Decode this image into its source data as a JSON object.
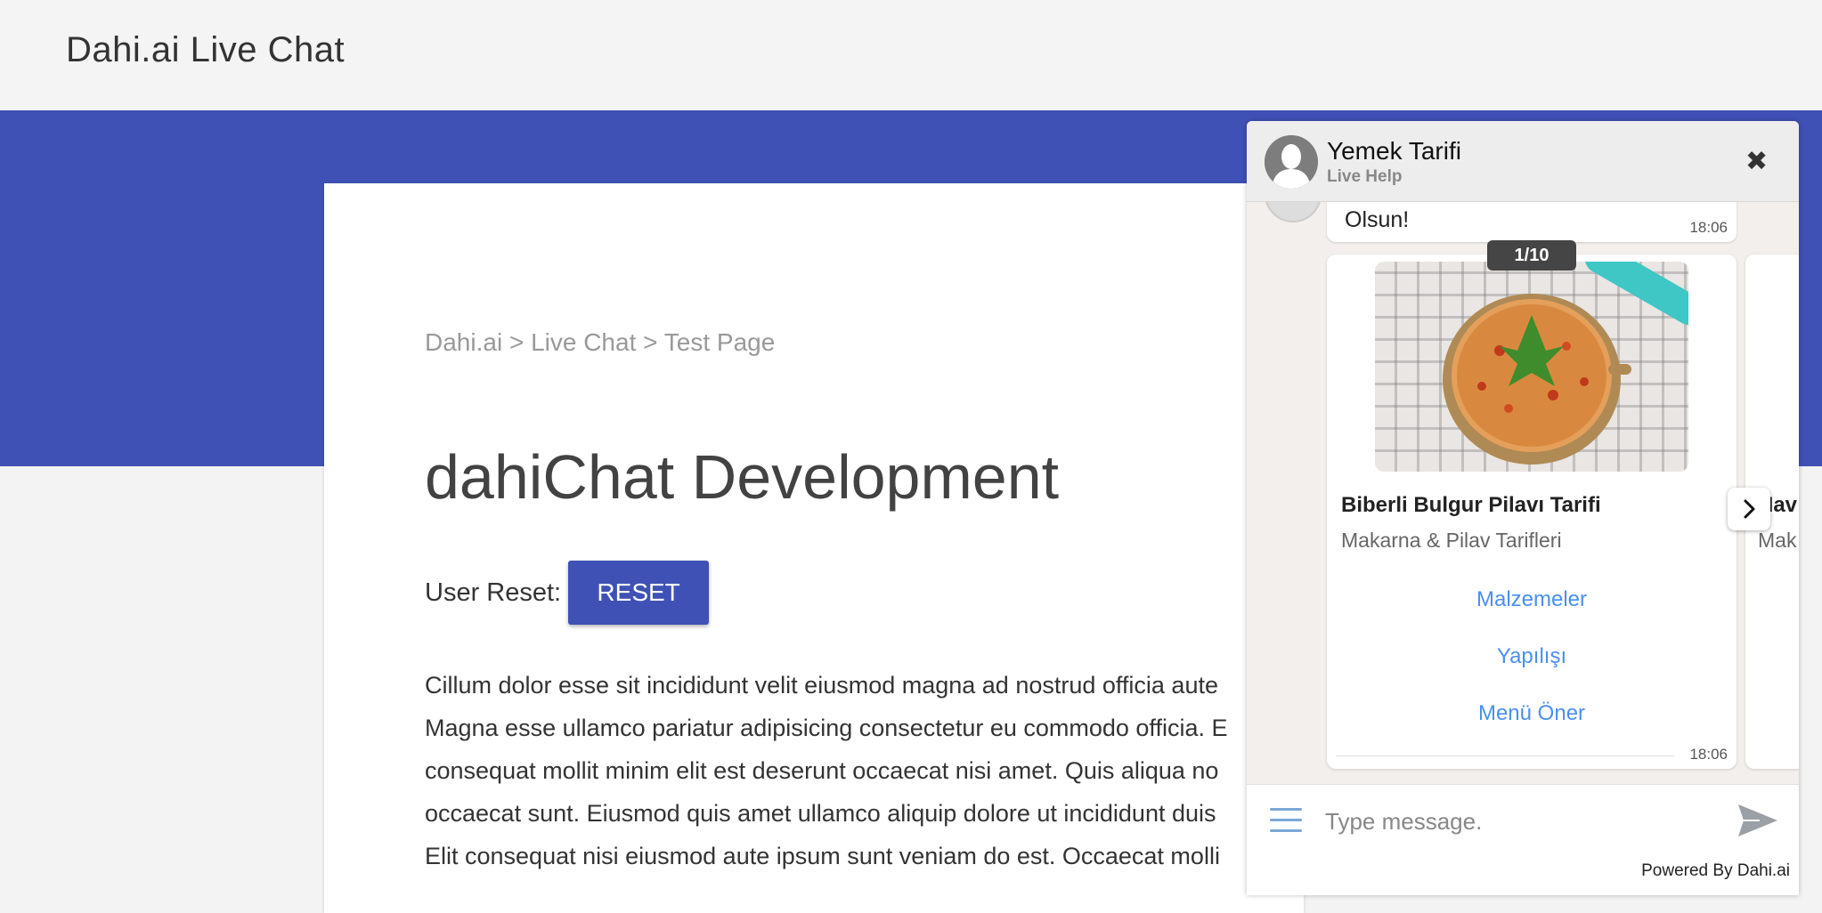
{
  "header": {
    "brand": "Dahi.ai Live Chat"
  },
  "page": {
    "breadcrumb": "Dahi.ai > Live Chat > Test Page",
    "title": "dahiChat Development",
    "reset_label": "User Reset:",
    "reset_button": "RESET",
    "body_lines": [
      "Cillum dolor esse sit incididunt velit eiusmod magna ad nostrud officia aute",
      "Magna esse ullamco pariatur adipisicing consectetur eu commodo officia. E",
      "consequat mollit minim elit est deserunt occaecat nisi amet. Quis aliqua no",
      "occaecat sunt. Eiusmod quis amet ullamco aliquip dolore ut incididunt duis",
      "Elit consequat nisi eiusmod aute ipsum sunt veniam do est. Occaecat molli"
    ]
  },
  "chat": {
    "name": "Yemek Tarifi",
    "subtitle": "Live Help",
    "previous_message": {
      "text": "Olsun!",
      "time": "18:06"
    },
    "carousel": {
      "pager": "1/10",
      "card": {
        "title": "Biberli Bulgur Pilavı Tarifi",
        "subtitle": "Makarna & Pilav Tarifleri",
        "actions": [
          "Malzemeler",
          "Yapılışı",
          "Menü Öner"
        ],
        "time": "18:06"
      },
      "next_card": {
        "title": "Hav",
        "subtitle": "Mak"
      }
    },
    "input_placeholder": "Type message.",
    "powered_by": "Powered By Dahi.ai",
    "colors": {
      "header_bg": "#ededed",
      "link": "#4a8ff0",
      "send": "#9aa0a6"
    }
  },
  "colors": {
    "primary": "#3f51b5",
    "page_bg": "#f3f3f3"
  }
}
